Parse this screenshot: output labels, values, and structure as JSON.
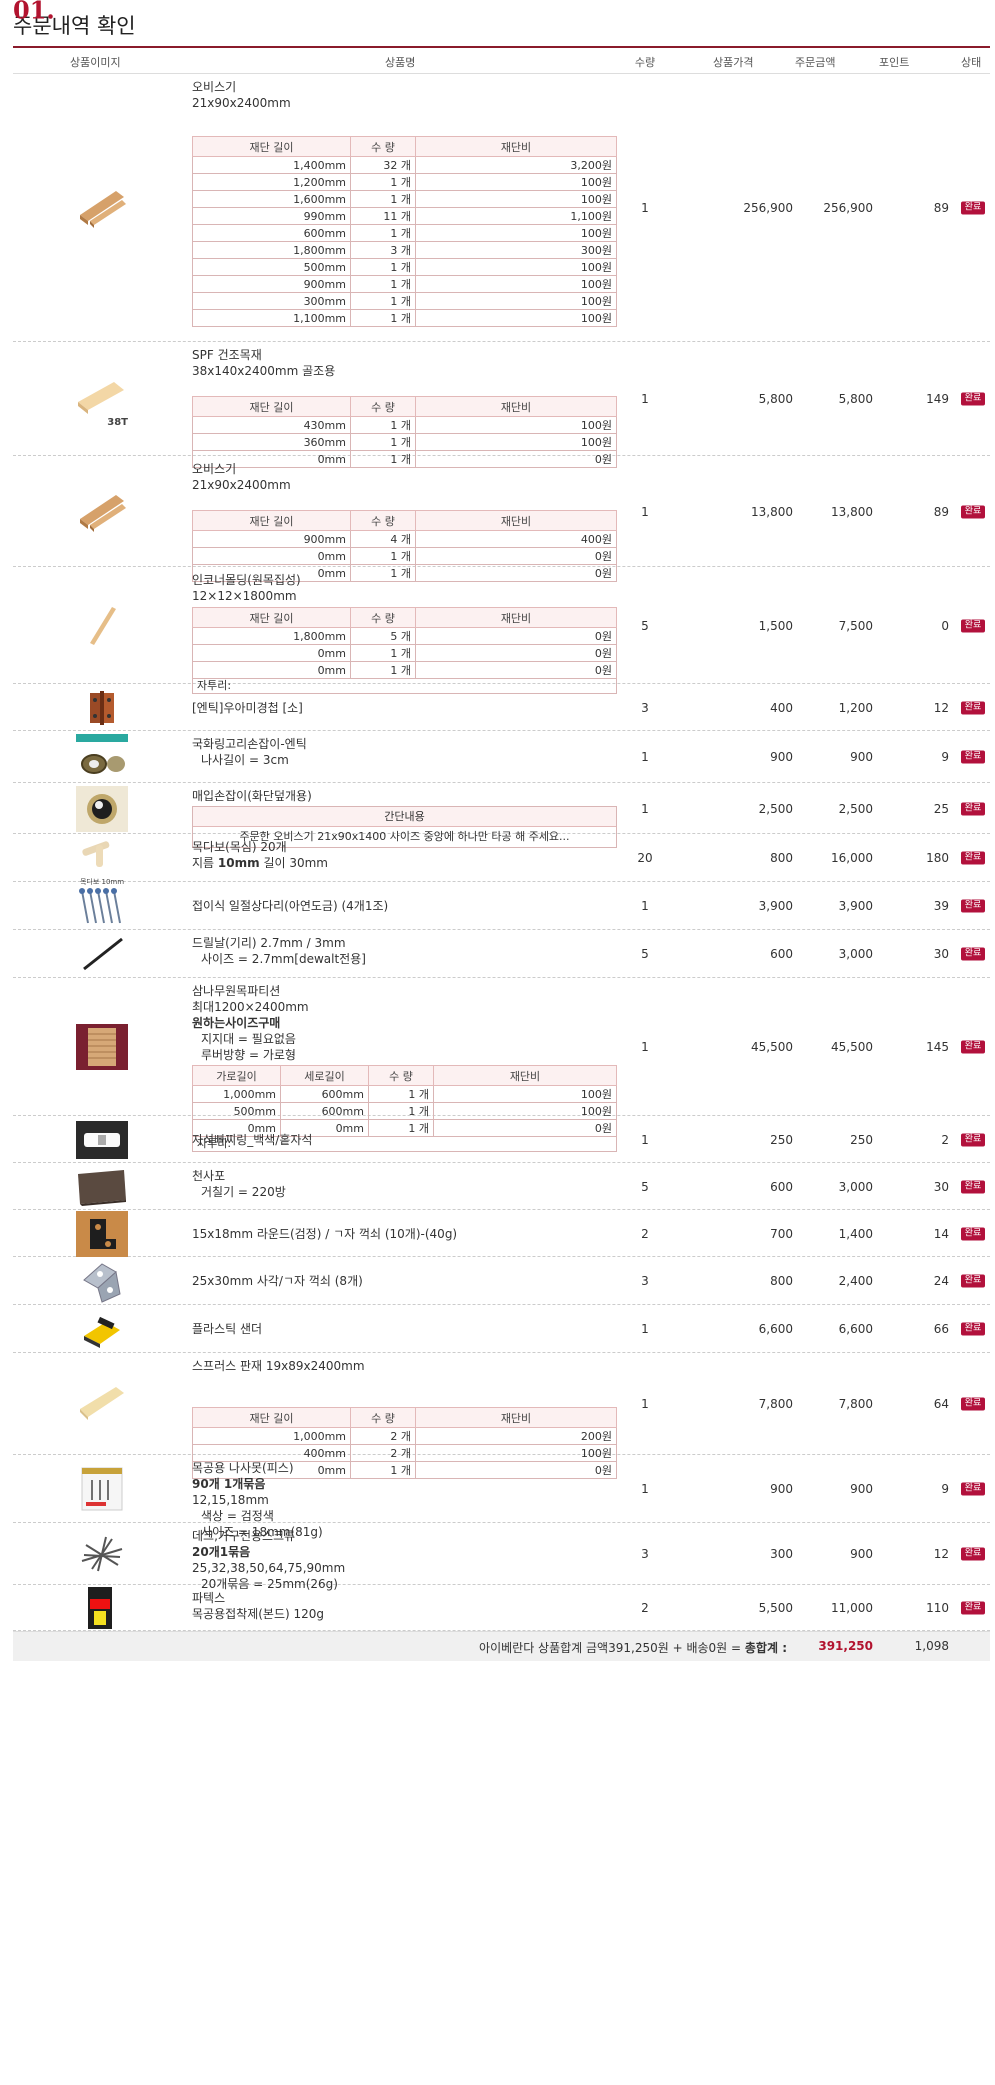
{
  "page": {
    "title_num": "01.",
    "title": "주문내역 확인"
  },
  "header": {
    "image": "상품이미지",
    "name": "상품명",
    "qty": "수량",
    "price": "상품가격",
    "order": "주문금액",
    "point": "포인트",
    "status": "상태"
  },
  "cut_headers": {
    "len": "재단 길이",
    "qty": "수 량",
    "fee": "재단비"
  },
  "cut_headers2": {
    "w": "가로길이",
    "h": "세로길이",
    "qty": "수 량",
    "fee": "재단비"
  },
  "rows": [
    {
      "img": "wood-strips",
      "lines": [
        {
          "t": "오비스기"
        },
        {
          "t": "21x90x2400mm"
        }
      ],
      "cuts": [
        [
          "1,400mm",
          "32 개",
          "3,200원"
        ],
        [
          "1,200mm",
          "1 개",
          "100원"
        ],
        [
          "1,600mm",
          "1 개",
          "100원"
        ],
        [
          "990mm",
          "11 개",
          "1,100원"
        ],
        [
          "600mm",
          "1 개",
          "100원"
        ],
        [
          "1,800mm",
          "3 개",
          "300원"
        ],
        [
          "500mm",
          "1 개",
          "100원"
        ],
        [
          "900mm",
          "1 개",
          "100원"
        ],
        [
          "300mm",
          "1 개",
          "100원"
        ],
        [
          "1,100mm",
          "1 개",
          "100원"
        ]
      ],
      "qty": "1",
      "price": "256,900",
      "order": "256,900",
      "point": "89",
      "status": "완료"
    },
    {
      "img": "wood-38t",
      "img_label": "38T",
      "lines": [
        {
          "t": "SPF 건조목재"
        },
        {
          "t": "38x140x2400mm 골조용"
        }
      ],
      "cuts": [
        [
          "430mm",
          "1 개",
          "100원"
        ],
        [
          "360mm",
          "1 개",
          "100원"
        ],
        [
          "0mm",
          "1 개",
          "0원"
        ]
      ],
      "qty": "1",
      "price": "5,800",
      "order": "5,800",
      "point": "149",
      "status": "완료"
    },
    {
      "img": "wood-strips",
      "lines": [
        {
          "t": "오비스기"
        },
        {
          "t": "21x90x2400mm"
        }
      ],
      "cuts": [
        [
          "900mm",
          "4 개",
          "400원"
        ],
        [
          "0mm",
          "1 개",
          "0원"
        ],
        [
          "0mm",
          "1 개",
          "0원"
        ]
      ],
      "qty": "1",
      "price": "13,800",
      "order": "13,800",
      "point": "89",
      "status": "완료"
    },
    {
      "img": "wood-stick",
      "lines": [
        {
          "t": "인코너몰딩(원목집성)"
        },
        {
          "t": "12×12×1800mm"
        }
      ],
      "cuts": [
        [
          "1,800mm",
          "5 개",
          "0원"
        ],
        [
          "0mm",
          "1 개",
          "0원"
        ],
        [
          "0mm",
          "1 개",
          "0원"
        ]
      ],
      "note": "자투리:",
      "qty": "5",
      "price": "1,500",
      "order": "7,500",
      "point": "0",
      "status": "완료"
    },
    {
      "img": "hinge",
      "lines": [
        {
          "t": "[엔틱]우아미경첩 [소]"
        }
      ],
      "qty": "3",
      "price": "400",
      "order": "1,200",
      "point": "12",
      "status": "완료"
    },
    {
      "img": "ring-pull",
      "lines": [
        {
          "t": "국화링고리손잡이-엔틱"
        },
        {
          "t": "나사길이 = 3cm",
          "c": "ind"
        }
      ],
      "qty": "1",
      "price": "900",
      "order": "900",
      "point": "9",
      "status": "완료"
    },
    {
      "img": "flush-knob",
      "lines": [
        {
          "t": "매입손잡이(화단덮개용)"
        }
      ],
      "memo": {
        "h": "간단내용",
        "b": "주문한 오비스기 21x90x1400 사이즈 중앙에 하나만 타공 해 주세요..."
      },
      "qty": "1",
      "price": "2,500",
      "order": "2,500",
      "point": "25",
      "status": "완료"
    },
    {
      "img": "dowel",
      "img_label": "목다보 10mm",
      "lines": [
        {
          "t": "목다보(목심) 20개"
        },
        {
          "t": "지름 10mm 길이 30mm",
          "bold": "10mm"
        }
      ],
      "qty": "20",
      "price": "800",
      "order": "16,000",
      "point": "180",
      "status": "완료"
    },
    {
      "img": "brackets",
      "lines": [
        {
          "t": "접이식 일절상다리(아연도금) (4개1조)"
        }
      ],
      "qty": "1",
      "price": "3,900",
      "order": "3,900",
      "point": "39",
      "status": "완료"
    },
    {
      "img": "drill",
      "lines": [
        {
          "t": "드릴날(기리) 2.7mm / 3mm"
        },
        {
          "t": "사이즈 = 2.7mm[dewalt전용]",
          "c": "ind"
        }
      ],
      "qty": "5",
      "price": "600",
      "order": "3,000",
      "point": "30",
      "status": "완료"
    },
    {
      "img": "partition",
      "lines": [
        {
          "t": "삼나무원목파티션"
        },
        {
          "t": "최대1200×2400mm"
        },
        {
          "t": "원하는사이즈구매",
          "c": "b"
        },
        {
          "t": "지지대 = 필요없음",
          "c": "ind"
        },
        {
          "t": "루버방향 = 가로형",
          "c": "ind"
        }
      ],
      "cuts2": [
        [
          "1,000mm",
          "600mm",
          "1 개",
          "100원"
        ],
        [
          "500mm",
          "600mm",
          "1 개",
          "100원"
        ],
        [
          "0mm",
          "0mm",
          "1 개",
          "0원"
        ]
      ],
      "note": "자투리:",
      "qty": "1",
      "price": "45,500",
      "order": "45,500",
      "point": "145",
      "status": "완료"
    },
    {
      "img": "magnet",
      "lines": [
        {
          "t": "자석빠찌링_백색/홑자석"
        }
      ],
      "qty": "1",
      "price": "250",
      "order": "250",
      "point": "2",
      "status": "완료"
    },
    {
      "img": "sandpaper",
      "lines": [
        {
          "t": "천사포"
        },
        {
          "t": "거칠기 = 220방",
          "c": "ind"
        }
      ],
      "qty": "5",
      "price": "600",
      "order": "3,000",
      "point": "30",
      "status": "완료"
    },
    {
      "img": "angle-black",
      "lines": [
        {
          "t": "15x18mm 라운드(검정) / ㄱ자 꺽쇠 (10개)-(40g)"
        }
      ],
      "qty": "2",
      "price": "700",
      "order": "1,400",
      "point": "14",
      "status": "완료"
    },
    {
      "img": "angle-silver",
      "lines": [
        {
          "t": "25x30mm 사각/ㄱ자 꺽쇠 (8개)"
        }
      ],
      "qty": "3",
      "price": "800",
      "order": "2,400",
      "point": "24",
      "status": "완료"
    },
    {
      "img": "sander",
      "lines": [
        {
          "t": "플라스틱 샌더"
        }
      ],
      "qty": "1",
      "price": "6,600",
      "order": "6,600",
      "point": "66",
      "status": "완료"
    },
    {
      "img": "board",
      "lines": [
        {
          "t": "스프러스 판재 19x89x2400mm"
        }
      ],
      "cuts": [
        [
          "1,000mm",
          "2 개",
          "200원"
        ],
        [
          "400mm",
          "2 개",
          "100원"
        ],
        [
          "0mm",
          "1 개",
          "0원"
        ]
      ],
      "qty": "1",
      "price": "7,800",
      "order": "7,800",
      "point": "64",
      "status": "완료"
    },
    {
      "img": "screws-pack",
      "lines": [
        {
          "t": "목공용 나사못(피스)"
        },
        {
          "t": "90개 1개묶음",
          "c": "b"
        },
        {
          "t": "12,15,18mm"
        },
        {
          "t": "색상 = 검정색",
          "c": "ind"
        },
        {
          "t": "사이즈 = 18mm(81g)",
          "c": "ind"
        }
      ],
      "qty": "1",
      "price": "900",
      "order": "900",
      "point": "9",
      "status": "완료"
    },
    {
      "img": "screws-pile",
      "lines": [
        {
          "t": "데크,가구전용스크류"
        },
        {
          "t": "20개1묶음",
          "c": "b"
        },
        {
          "t": "25,32,38,50,64,75,90mm"
        },
        {
          "t": "20개묶음 = 25mm(26g)",
          "c": "ind"
        }
      ],
      "qty": "3",
      "price": "300",
      "order": "900",
      "point": "12",
      "status": "완료"
    },
    {
      "img": "glue",
      "lines": [
        {
          "t": "파텍스"
        },
        {
          "t": "목공용접착제(본드) 120g"
        }
      ],
      "qty": "2",
      "price": "5,500",
      "order": "11,000",
      "point": "110",
      "status": "완료"
    }
  ],
  "footer": {
    "text_pre": "아이베란다 상품합계 금액391,250원 + 배송0원 = ",
    "text_label": "총합계 :",
    "total": "391,250",
    "points": "1,098"
  }
}
